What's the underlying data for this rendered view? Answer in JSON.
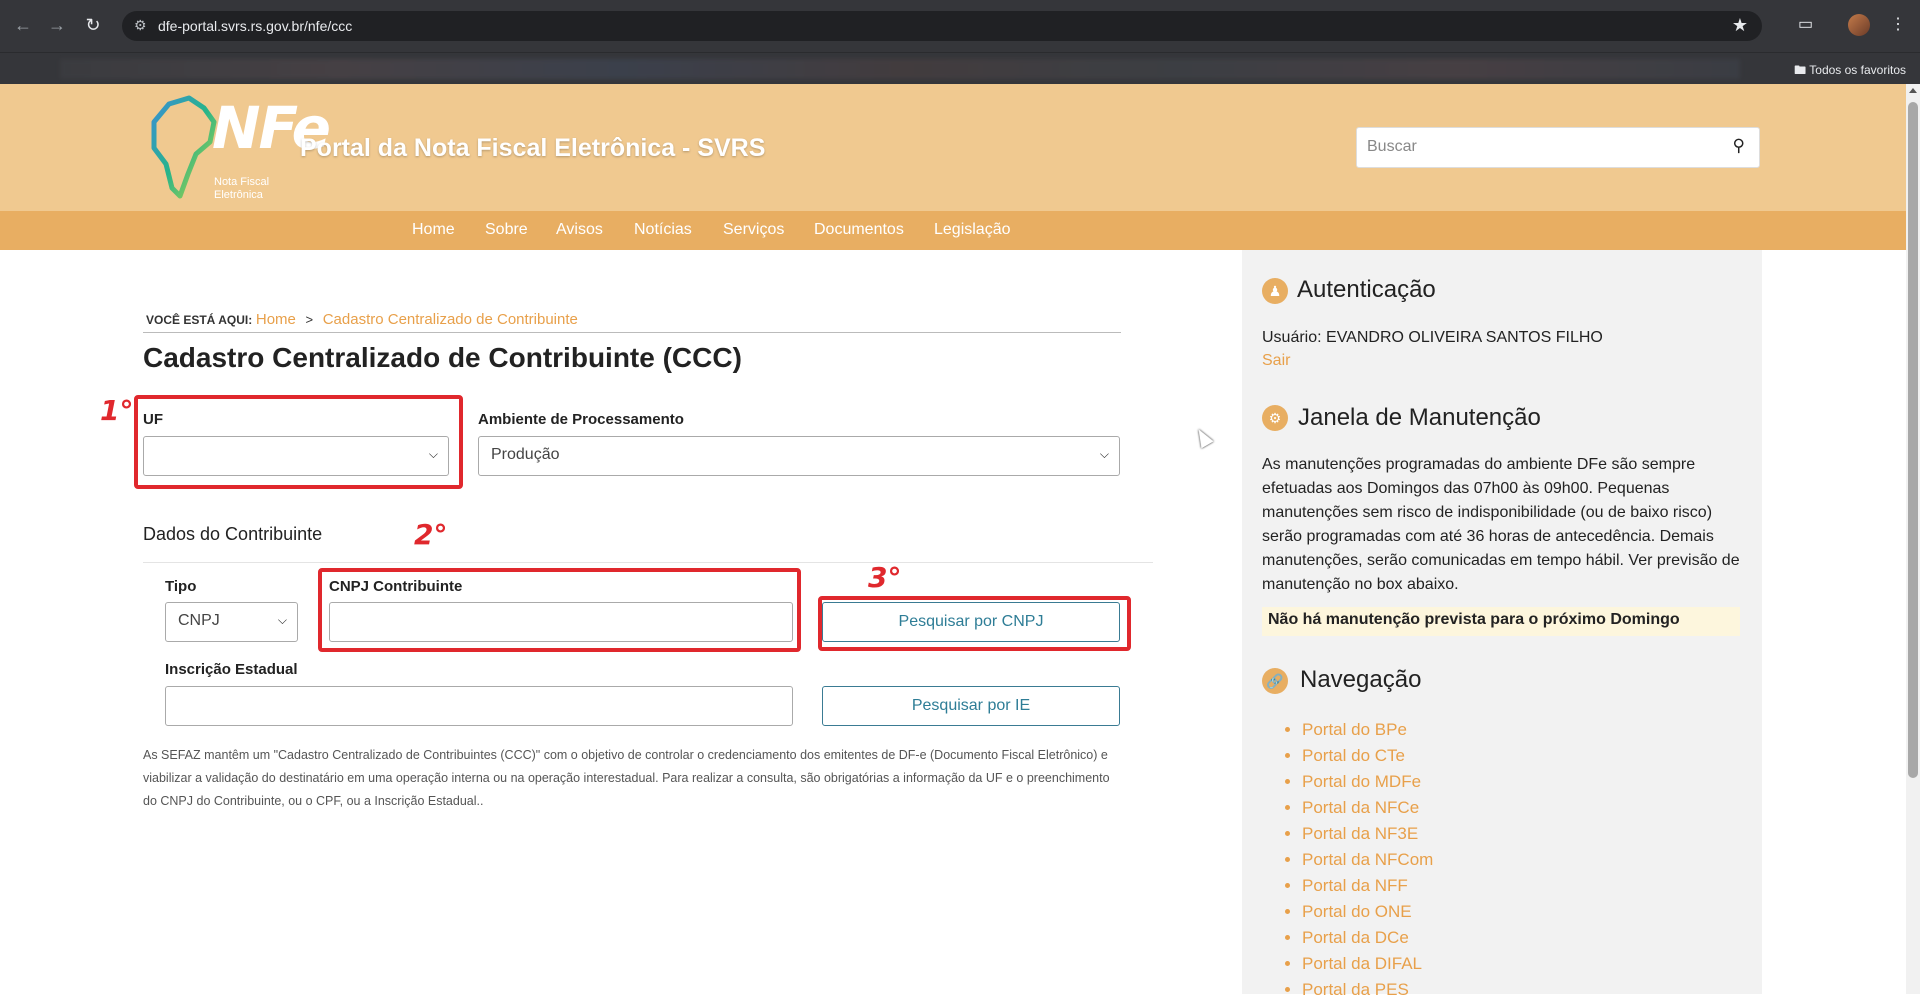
{
  "browser": {
    "url": "dfe-portal.svrs.rs.gov.br/nfe/ccc",
    "bookmarks_folder": "Todos os favoritos"
  },
  "header": {
    "logo_text": "NFe",
    "logo_sub_1": "Nota Fiscal",
    "logo_sub_2": "Eletrônica",
    "title": "Portal da Nota Fiscal Eletrônica - SVRS",
    "search_placeholder": "Buscar"
  },
  "menu": [
    "Home",
    "Sobre",
    "Avisos",
    "Notícias",
    "Serviços",
    "Documentos",
    "Legislação"
  ],
  "breadcrumb": {
    "label": "VOCÊ ESTÁ AQUI:",
    "home": "Home",
    "separator": ">",
    "current": "Cadastro Centralizado de Contribuinte"
  },
  "page_title": "Cadastro Centralizado de Contribuinte (CCC)",
  "form": {
    "uf_label": "UF",
    "uf_value": "",
    "ambiente_label": "Ambiente de Processamento",
    "ambiente_value": "Produção",
    "section_title": "Dados do Contribuinte",
    "tipo_label": "Tipo",
    "tipo_value": "CNPJ",
    "cnpj_label": "CNPJ Contribuinte",
    "cnpj_value": "",
    "ie_label": "Inscrição Estadual",
    "ie_value": "",
    "btn_cnpj": "Pesquisar por CNPJ",
    "btn_ie": "Pesquisar por IE"
  },
  "description": "As SEFAZ mantêm um \"Cadastro Centralizado de Contribuintes (CCC)\" com o objetivo de controlar o credenciamento dos emitentes de DF-e (Documento Fiscal Eletrônico) e viabilizar a validação do destinatário em uma operação interna ou na operação interestadual. Para realizar a consulta, são obrigatórias a informação da UF e o preenchimento do CNPJ do Contribuinte, ou o CPF, ou a Inscrição Estadual..",
  "annotations": [
    "1°",
    "2°",
    "3°"
  ],
  "sidebar": {
    "auth_title": "Autenticação",
    "user_label": "Usuário: EVANDRO OLIVEIRA SANTOS FILHO",
    "logout": "Sair",
    "maint_title": "Janela de Manutenção",
    "maint_text": "As manutenções programadas do ambiente DFe são sempre efetuadas aos Domingos das 07h00 às 09h00. Pequenas manutenções sem risco de indisponibilidade (ou de baixo risco) serão programadas com até 36 horas de antecedência. Demais manutenções, serão comunicadas em tempo hábil. Ver previsão de manutenção no box abaixo.",
    "maint_notice": "Não há manutenção prevista para o próximo Domingo",
    "nav_title": "Navegação",
    "nav_links": [
      "Portal do BPe",
      "Portal do CTe",
      "Portal do MDFe",
      "Portal da NFCe",
      "Portal da NF3E",
      "Portal da NFCom",
      "Portal da NFF",
      "Portal do ONE",
      "Portal da DCe",
      "Portal da DIFAL",
      "Portal da PES"
    ]
  },
  "colors": {
    "header_bg": "#f0c990",
    "menu_bg": "#e8ae62",
    "link": "#e8a04a",
    "button": "#2e7d96",
    "annotation": "#e0282d"
  }
}
